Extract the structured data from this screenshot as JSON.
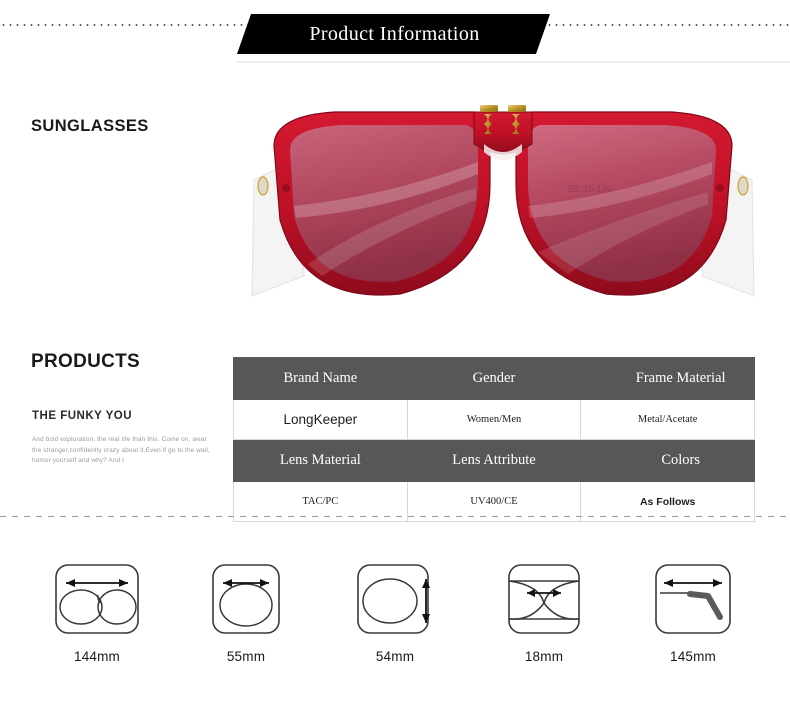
{
  "header": {
    "title": "Product Information"
  },
  "sections": {
    "sunglasses_label": "SUNGLASSES",
    "products_label": "PRODUCTS"
  },
  "copy": {
    "heading": "THE FUNKY YOU",
    "body": "And bold exploration, the real life than this. Come on, wear the stranger,confidently crazy about it.Even if go to the wall, humor yourself and why? And t"
  },
  "product_photo": {
    "alt": "red aviator sunglasses with rose tinted lenses",
    "frame_color": "#c8102e",
    "lens_color": "#b94a5e",
    "temple_color": "#efefef",
    "hardware_color": "#c9a227"
  },
  "spec_table": {
    "rows": [
      {
        "type": "header",
        "cells": [
          "Brand Name",
          "Gender",
          "Frame Material"
        ]
      },
      {
        "type": "value",
        "cells": [
          "LongKeeper",
          "Women/Men",
          "Metal/Acetate"
        ]
      },
      {
        "type": "header",
        "cells": [
          "Lens Material",
          "Lens Attribute",
          "Colors"
        ]
      },
      {
        "type": "value",
        "cells": [
          "TAC/PC",
          "UV400/CE",
          "As Follows"
        ]
      }
    ],
    "header_bg": "#575757",
    "header_fg": "#ffffff"
  },
  "measurements": [
    {
      "icon": "frame-total-width-icon",
      "label": "144mm"
    },
    {
      "icon": "lens-width-icon",
      "label": "55mm"
    },
    {
      "icon": "lens-height-icon",
      "label": "54mm"
    },
    {
      "icon": "bridge-width-icon",
      "label": "18mm"
    },
    {
      "icon": "temple-length-icon",
      "label": "145mm"
    }
  ]
}
